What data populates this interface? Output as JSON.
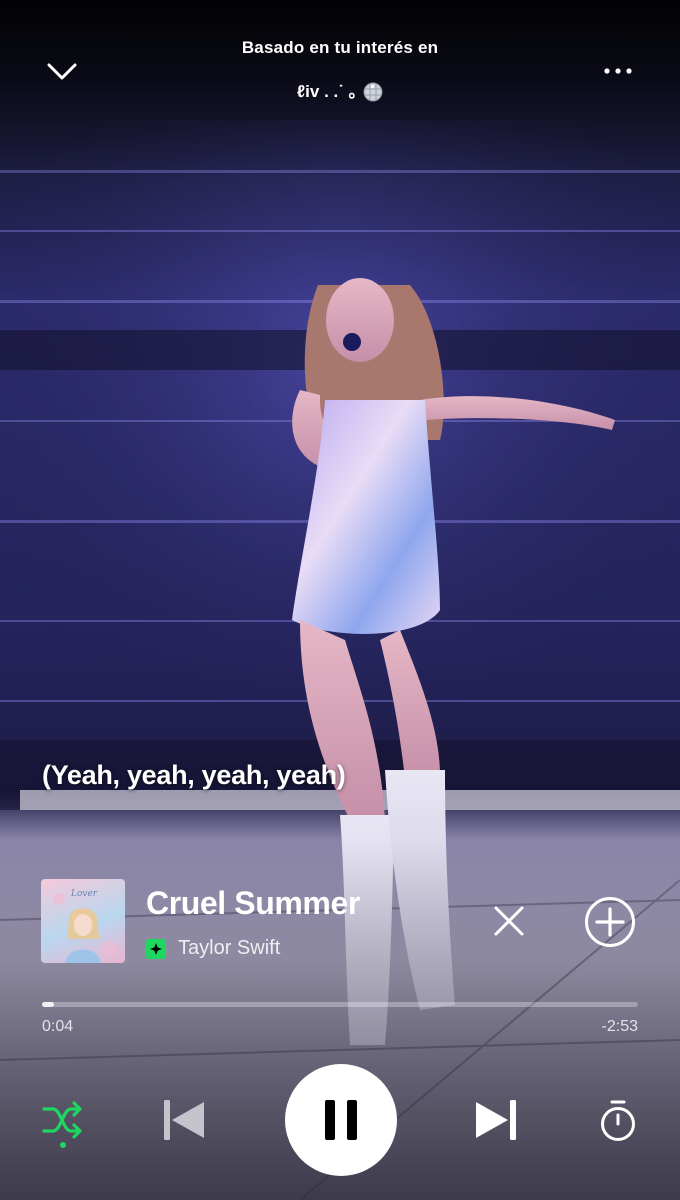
{
  "header": {
    "subtitle": "Basado en tu interés en",
    "playlist_name": "ℓiv .  .˙ ｡",
    "icons": {
      "collapse": "chevron-down-icon",
      "more": "more-horizontal-icon",
      "playlist_emoji": "disco-ball-icon"
    }
  },
  "lyric": {
    "line": "(Yeah, yeah, yeah, yeah)"
  },
  "track": {
    "title": "Cruel Summer",
    "artist": "Taylor Swift",
    "cover_text": "Lover",
    "downloaded": true,
    "icons": {
      "dismiss": "close-icon",
      "add": "add-circle-icon",
      "downloaded": "download-badge-icon"
    }
  },
  "playback": {
    "elapsed": "0:04",
    "remaining": "-2:53",
    "progress_fraction": 0.02,
    "is_playing": true,
    "shuffle_enabled": true
  },
  "controls": {
    "icons": {
      "shuffle": "shuffle-icon",
      "previous": "skip-previous-icon",
      "play_pause": "pause-icon",
      "next": "skip-next-icon",
      "sleep_timer": "timer-icon"
    }
  },
  "colors": {
    "accent": "#1ed760",
    "text": "#ffffff",
    "disabled": "#bfbfc8"
  }
}
